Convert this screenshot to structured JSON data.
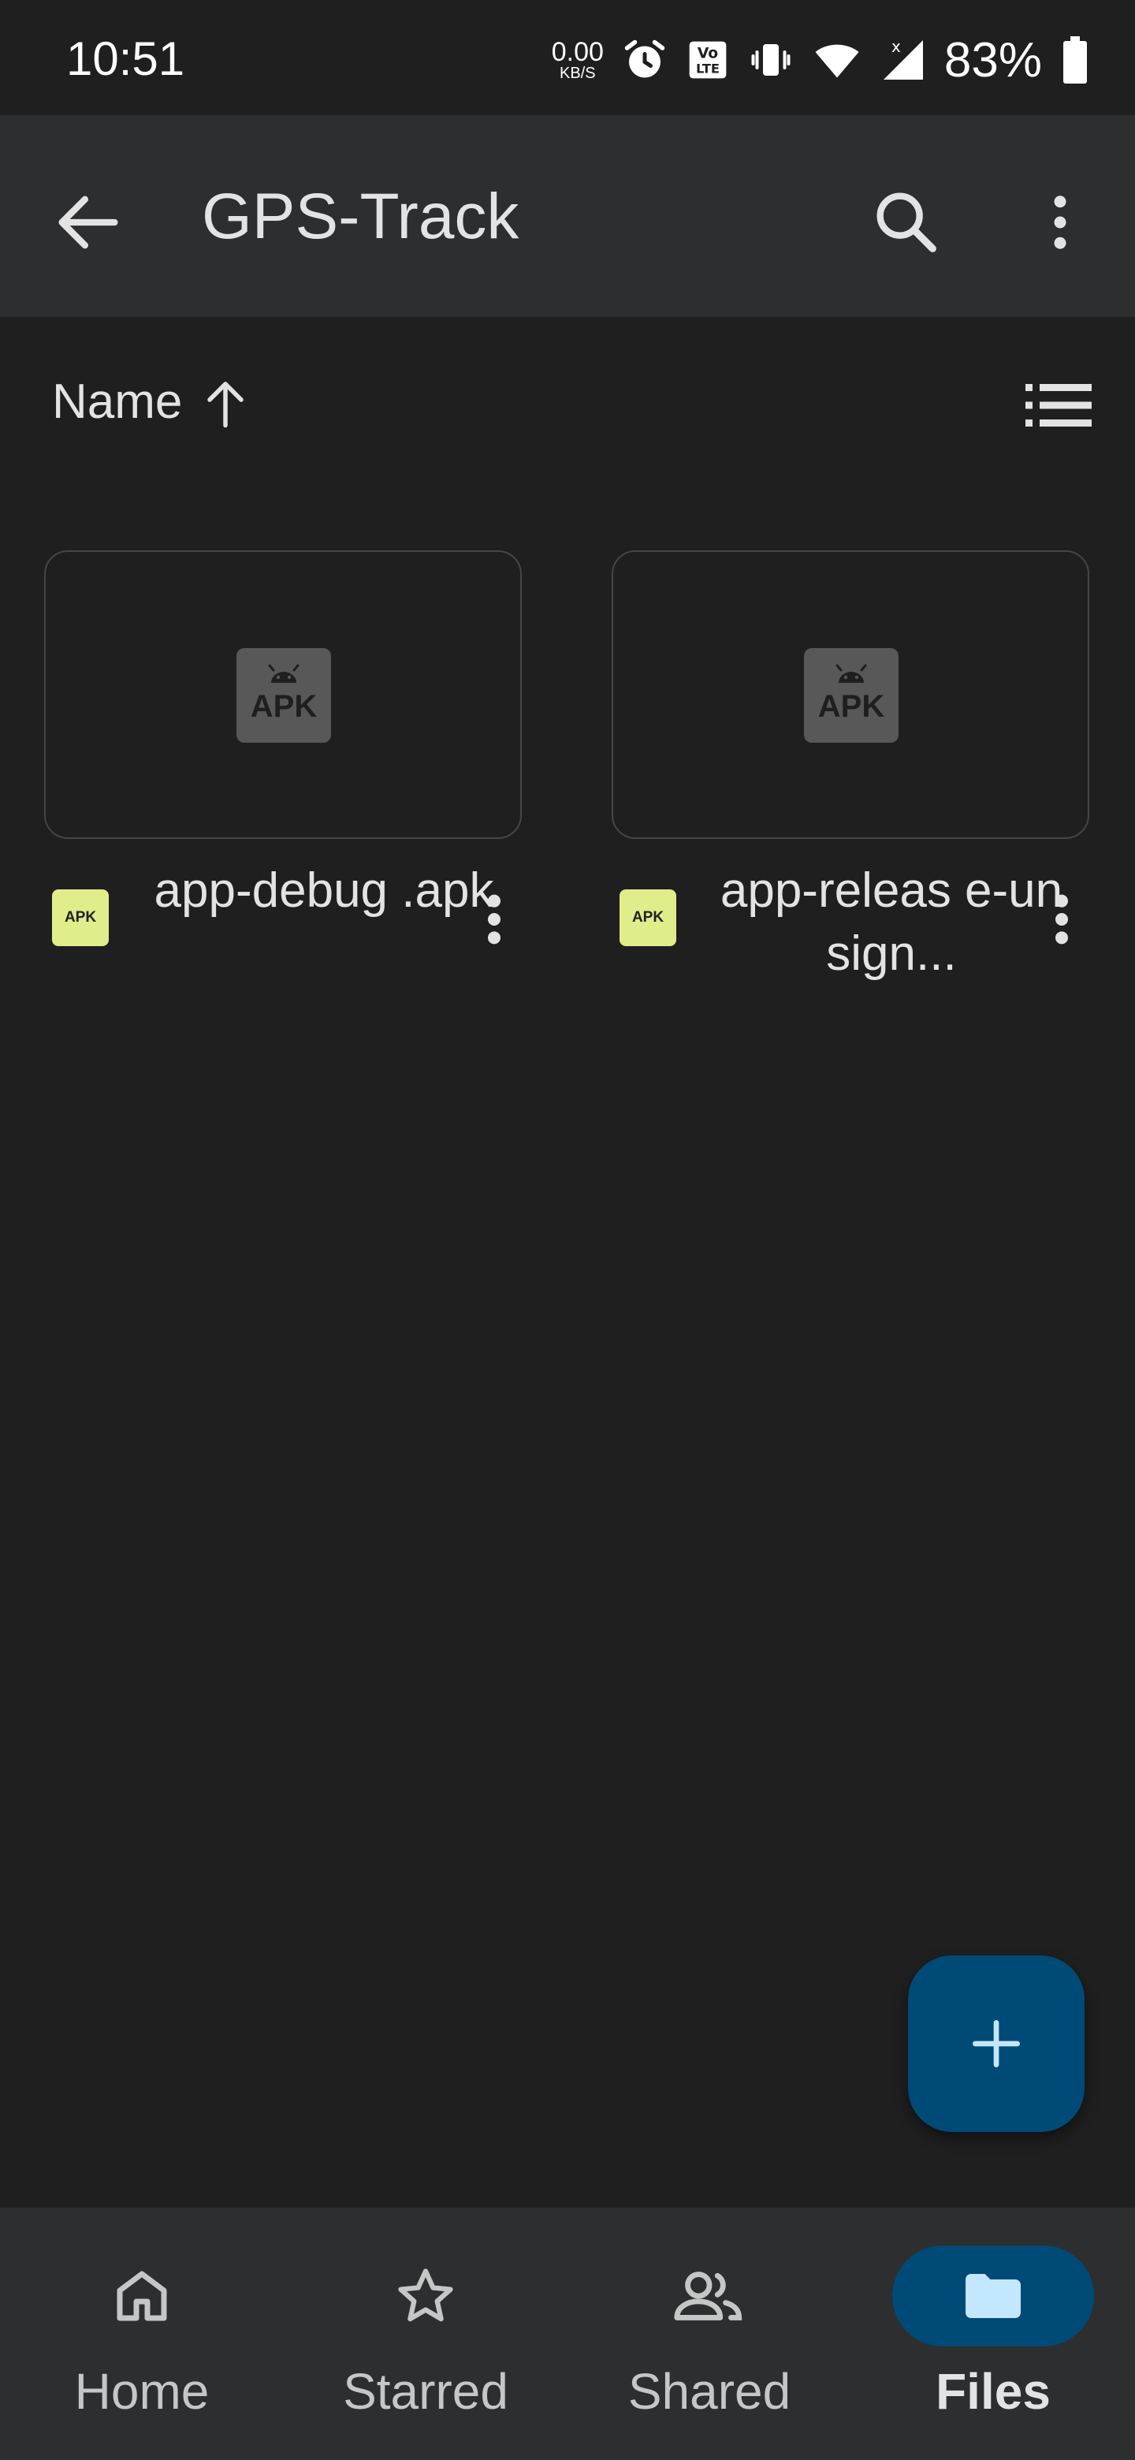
{
  "status_bar": {
    "time": "10:51",
    "net_speed_value": "0.00",
    "net_speed_unit": "KB/S",
    "battery_percent": "83%",
    "icons": [
      "alarm-icon",
      "volte-icon",
      "vibrate-icon",
      "wifi-icon",
      "cell-signal-icon",
      "battery-icon"
    ]
  },
  "app_bar": {
    "title": "GPS-Track",
    "icons": [
      "back-arrow-icon",
      "search-icon",
      "more-vert-icon"
    ]
  },
  "sort": {
    "label": "Name",
    "direction_icon": "arrow-up-icon",
    "view_icon": "list-view-icon"
  },
  "files": [
    {
      "name": "app-debug.apk",
      "display_name": "app-debug .apk",
      "type_badge": "APK",
      "thumb_label": "APK"
    },
    {
      "name": "app-release-unsigned",
      "display_name": "app-releas e-unsign...",
      "type_badge": "APK",
      "thumb_label": "APK"
    }
  ],
  "fab": {
    "icon": "plus-icon"
  },
  "bottom_nav": {
    "items": [
      {
        "label": "Home",
        "icon": "home-icon",
        "active": false
      },
      {
        "label": "Starred",
        "icon": "star-icon",
        "active": false
      },
      {
        "label": "Shared",
        "icon": "people-icon",
        "active": false
      },
      {
        "label": "Files",
        "icon": "folder-icon",
        "active": true
      }
    ]
  },
  "colors": {
    "background": "#1f1f1f",
    "surface": "#2d2e30",
    "accent": "#004a77",
    "apk_badge": "#e1ec8a"
  }
}
